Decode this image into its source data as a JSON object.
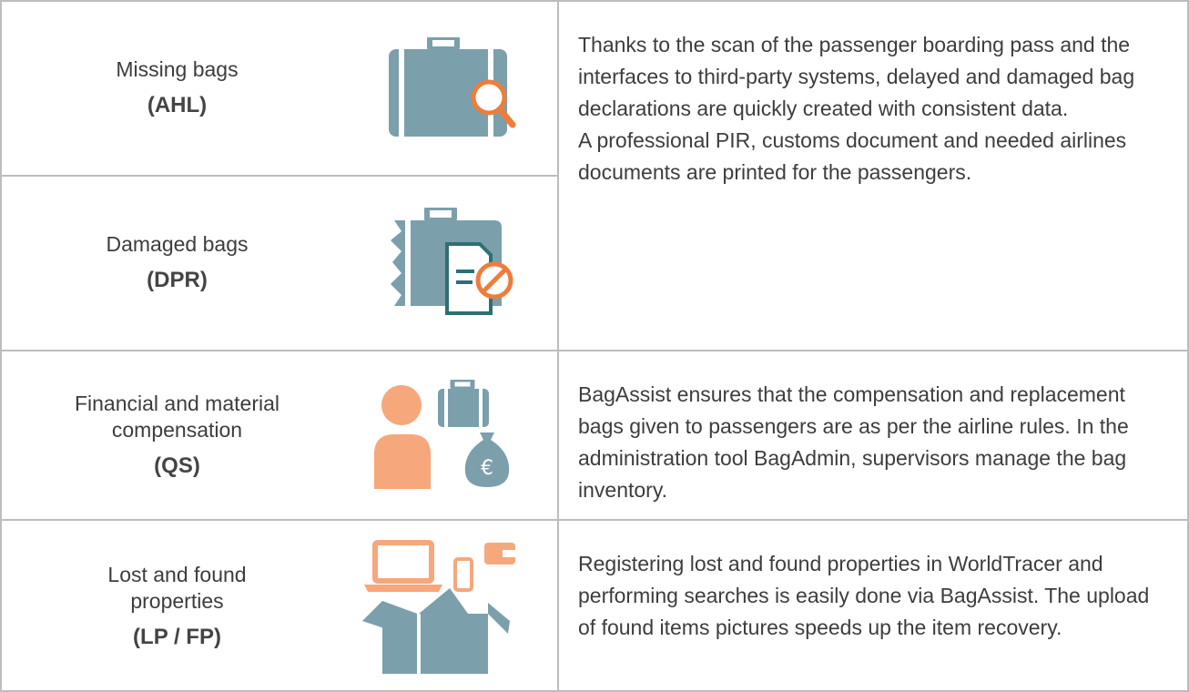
{
  "rows": [
    {
      "label": "Missing bags",
      "code": "(AHL)",
      "icon": "suitcase-search-icon"
    },
    {
      "label": "Damaged bags",
      "code": "(DPR)",
      "icon": "damaged-suitcase-document-icon"
    },
    {
      "label_line1": "Financial and material",
      "label_line2": "compensation",
      "code": "(QS)",
      "icon": "person-suitcase-money-icon"
    },
    {
      "label_line1": "Lost and found",
      "label_line2": "properties",
      "code": "(LP / FP)",
      "icon": "laptop-phone-wallet-box-icon"
    }
  ],
  "descriptions": {
    "bags_p1": "Thanks to the scan of the passenger boarding pass and the interfaces to third-party systems, delayed and damaged bag declarations are quickly created with consistent data.",
    "bags_p2": "A professional PIR, customs document and needed airlines documents are printed for the passengers.",
    "compensation": "BagAssist ensures that the compensation and replacement bags given to passengers are as per the airline rules. In the administration tool BagAdmin, supervisors manage the bag inventory.",
    "lost_found": "Registering lost and found properties in WorldTracer and performing searches is easily done via BagAssist. The upload of found items pictures speeds up the item recovery."
  },
  "colors": {
    "teal": "#7b9fab",
    "orange": "#ee7d3b",
    "peach": "#f6a77c",
    "dark_teal": "#2f6f73",
    "border": "#bdbdbd",
    "text": "#3d3d3d"
  }
}
